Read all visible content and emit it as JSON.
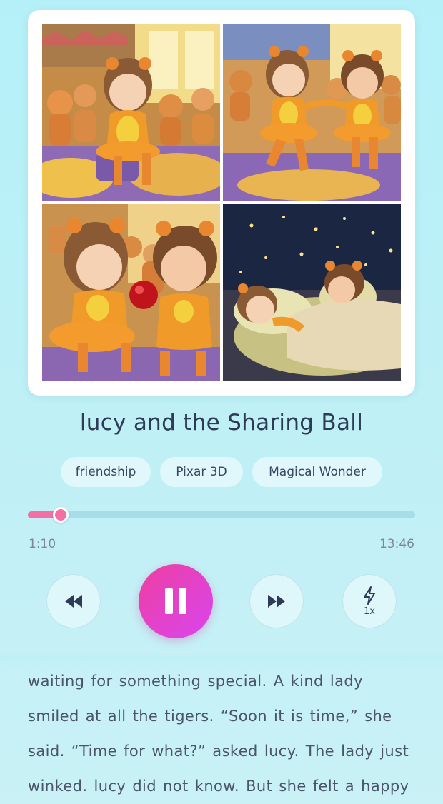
{
  "story": {
    "title": "lucy and the Sharing Ball",
    "tags": [
      "friendship",
      "Pixar 3D",
      "Magical Wonder"
    ],
    "text": "lucy looked around. She was excited. She was waiting for something special. A kind lady smiled at all the tigers.  “Soon it is time,”  she said.  “Time for what?”  asked lucy. The lady just winked. lucy did not know. But she felt a happy wiggle in her tummy."
  },
  "player": {
    "current_time": "1:10",
    "total_time": "13:46",
    "progress": 0.0848,
    "speed": "1x",
    "state": "playing"
  },
  "icons": {
    "rewind": "rewind-icon",
    "pause": "pause-icon",
    "forward": "fast-forward-icon",
    "speed": "lightning-icon"
  },
  "colors": {
    "accent": "#f56fa7",
    "play_button": "#e83ea6",
    "background": "#b9eff6"
  }
}
